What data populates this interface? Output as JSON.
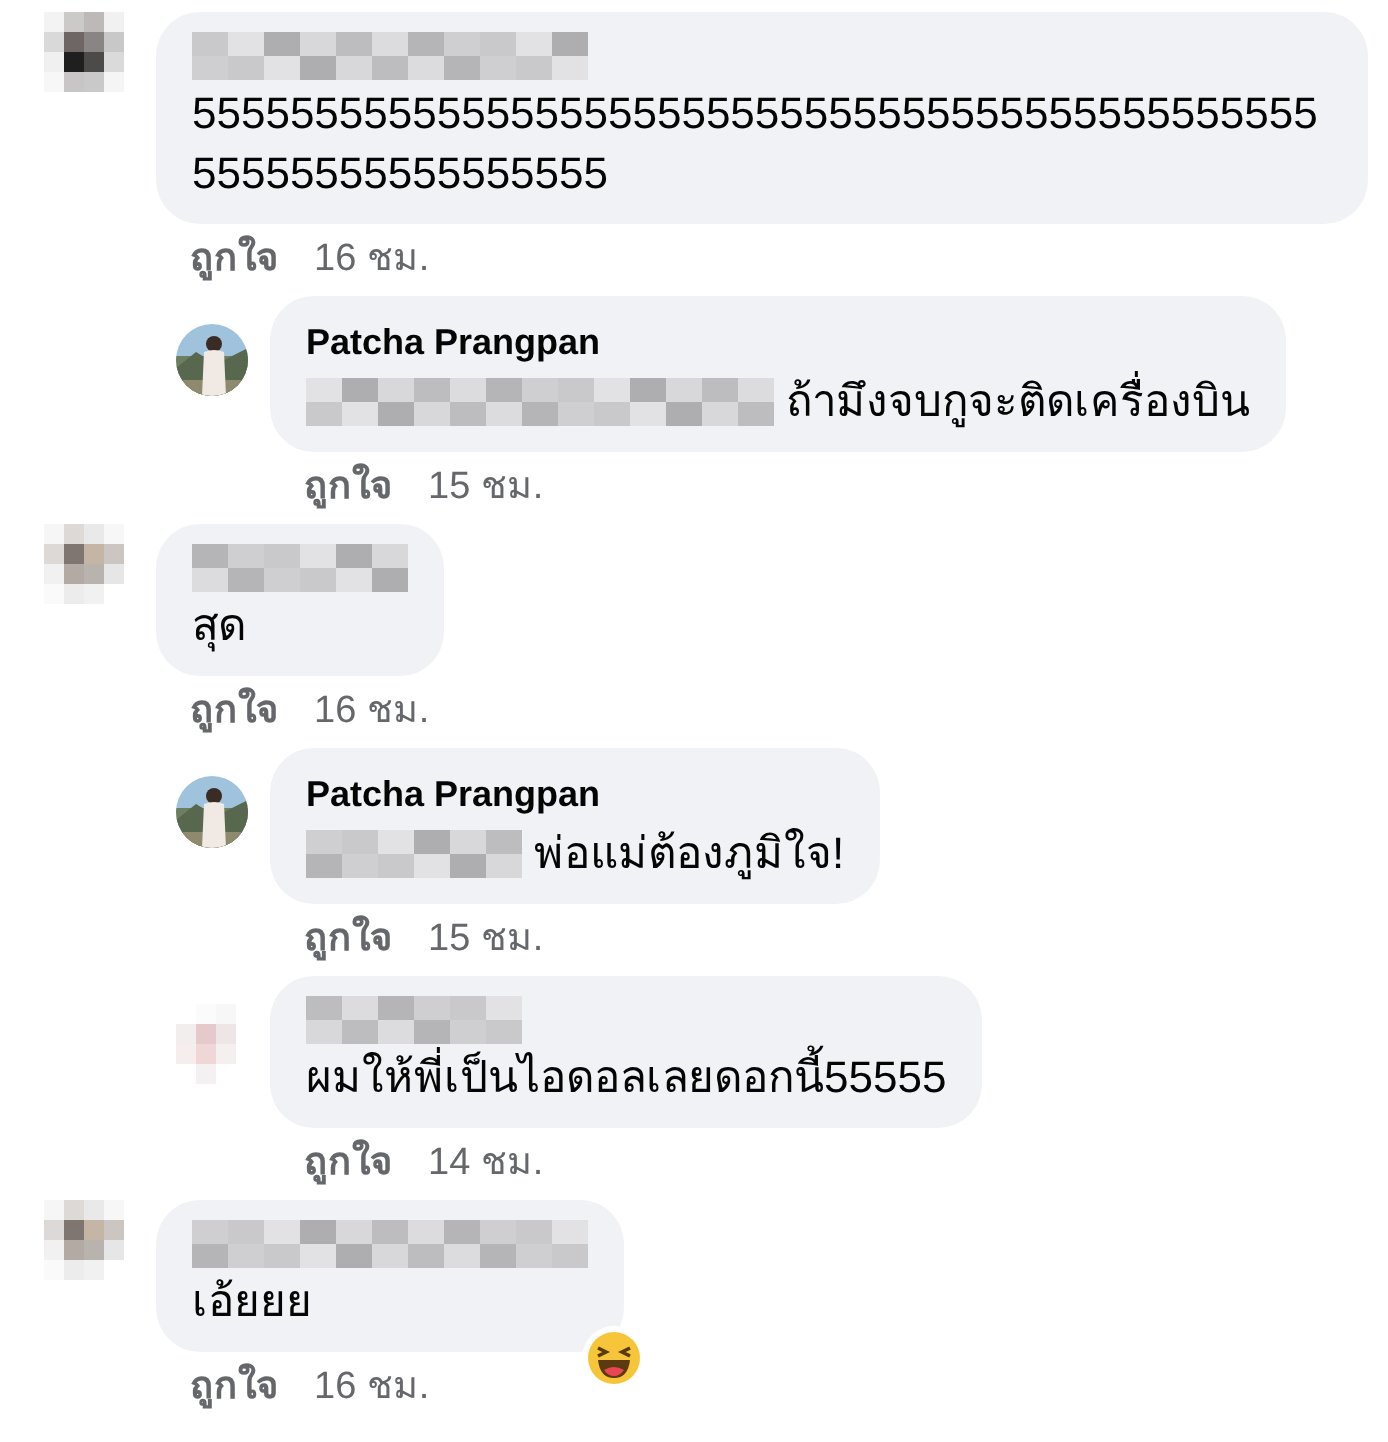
{
  "comments": [
    {
      "kind": "comment",
      "mention_hidden": false,
      "body": "555555555555555555555555555555555555555555555555555555555555555",
      "like": "ถูกใจ",
      "time": "16 ชม.",
      "reaction": false
    },
    {
      "kind": "reply",
      "author": "Patcha Prangpan",
      "mention_hidden": true,
      "body": "ถ้ามึงจบกูจะติดเครื่องบิน",
      "like": "ถูกใจ",
      "time": "15 ชม.",
      "reaction": false
    },
    {
      "kind": "comment",
      "mention_hidden": false,
      "body": "สุด",
      "like": "ถูกใจ",
      "time": "16 ชม.",
      "reaction": false
    },
    {
      "kind": "reply",
      "author": "Patcha Prangpan",
      "mention_hidden": true,
      "body": "พ่อแม่ต้องภูมิใจ!",
      "like": "ถูกใจ",
      "time": "15 ชม.",
      "reaction": false
    },
    {
      "kind": "reply",
      "mention_hidden": false,
      "body": "ผมให้พี่เป็นไอดอลเลยดอกนี้55555",
      "like": "ถูกใจ",
      "time": "14 ชม.",
      "reaction": false
    },
    {
      "kind": "comment",
      "mention_hidden": false,
      "body": "เอ้ยยย",
      "like": "ถูกใจ",
      "time": "16 ชม.",
      "reaction": true
    }
  ]
}
